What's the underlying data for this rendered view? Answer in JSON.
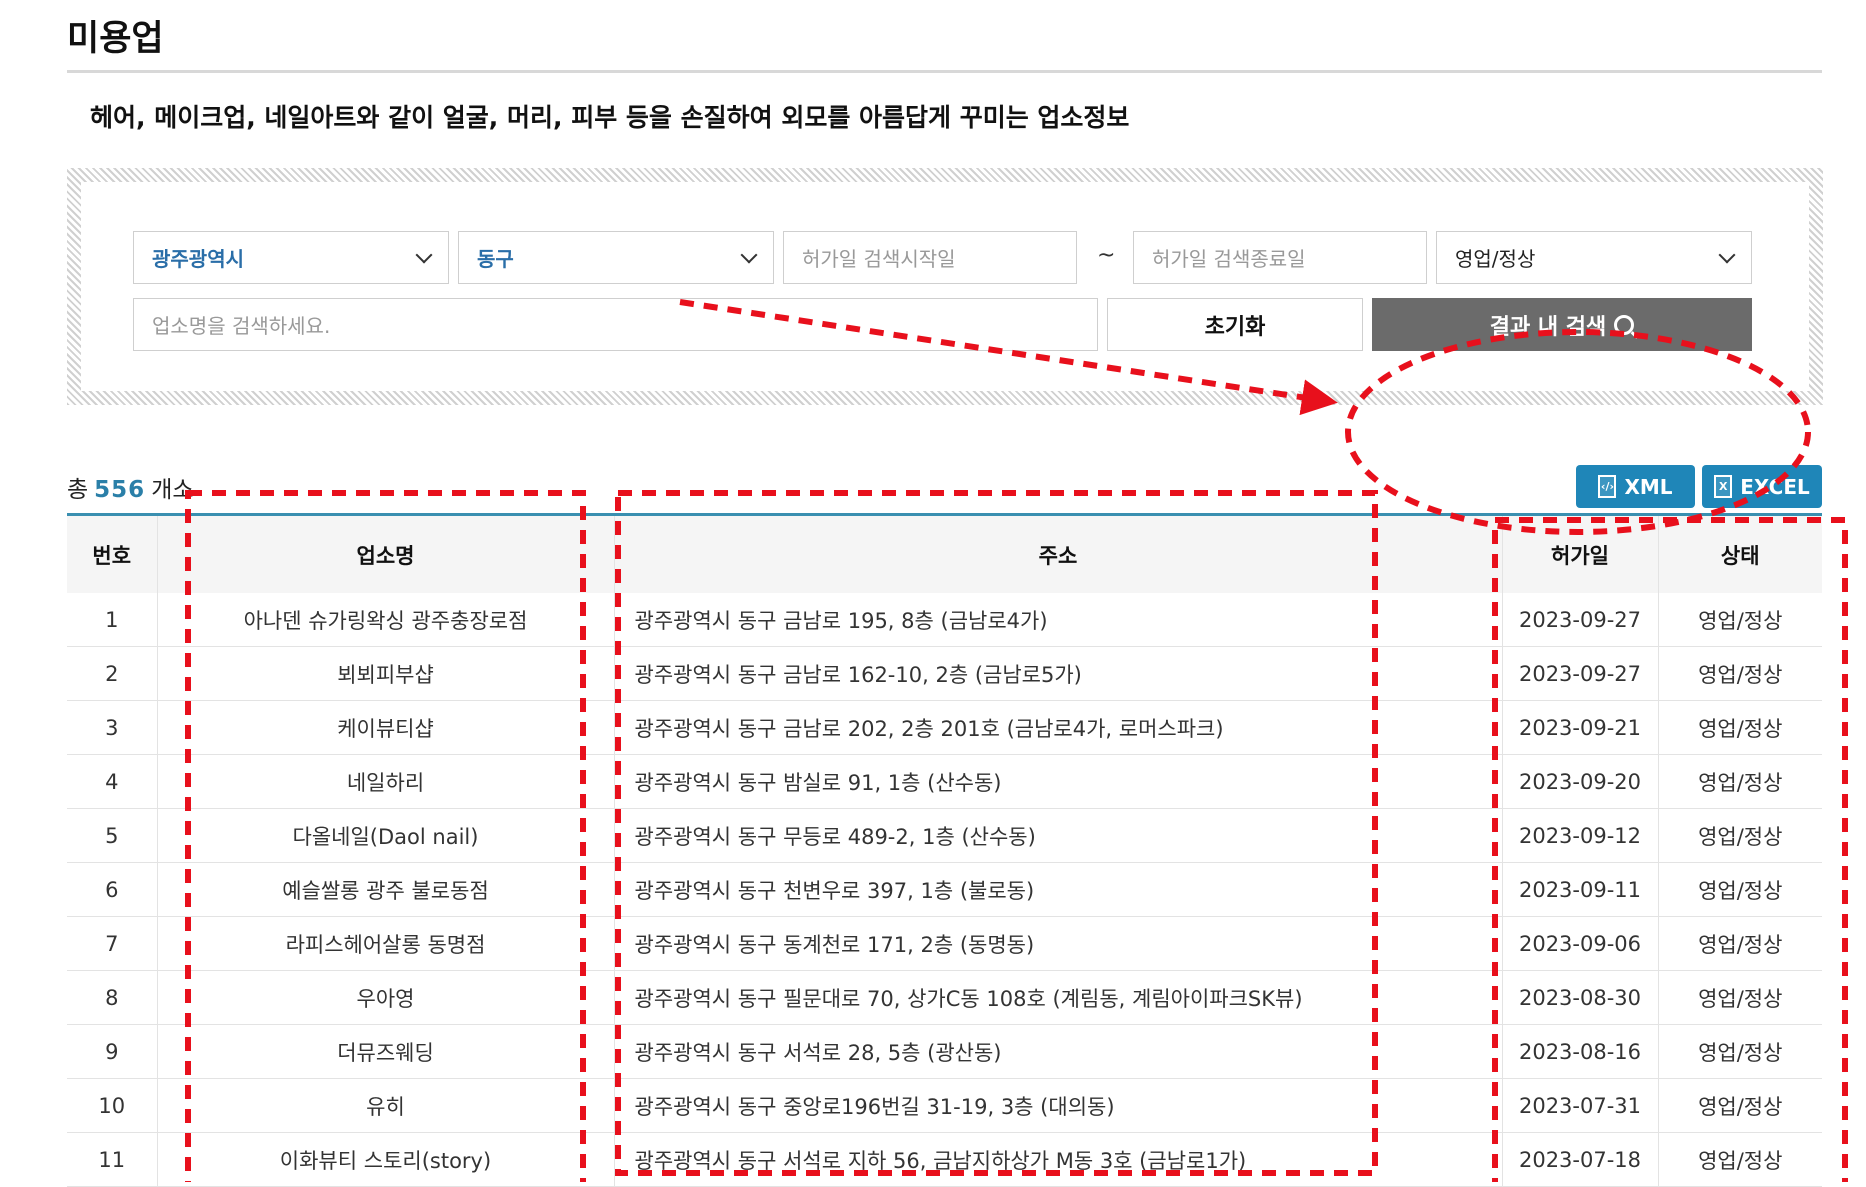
{
  "page": {
    "title": "미용업",
    "description": "헤어, 메이크업, 네일아트와 같이 얼굴, 머리, 피부 등을 손질하여 외모를 아름답게 꾸미는 업소정보"
  },
  "search": {
    "city": "광주광역시",
    "district": "동구",
    "start_date_placeholder": "허가일 검색시작일",
    "tilde": "~",
    "end_date_placeholder": "허가일 검색종료일",
    "status": "영업/정상",
    "name_placeholder": "업소명을 검색하세요.",
    "reset_label": "초기화",
    "search_label": "결과 내 검색"
  },
  "summary": {
    "prefix": "총",
    "count": "556",
    "suffix": "개소"
  },
  "downloads": {
    "xml_label": "XML",
    "excel_label": "EXCEL"
  },
  "table": {
    "headers": [
      "번호",
      "업소명",
      "주소",
      "허가일",
      "상태"
    ],
    "rows": [
      [
        "1",
        "아나덴 슈가링왁싱 광주충장로점",
        "광주광역시 동구 금남로 195, 8층 (금남로4가)",
        "2023-09-27",
        "영업/정상"
      ],
      [
        "2",
        "뵈뵈피부샵",
        "광주광역시 동구 금남로 162-10, 2층 (금남로5가)",
        "2023-09-27",
        "영업/정상"
      ],
      [
        "3",
        "케이뷰티샵",
        "광주광역시 동구 금남로 202, 2층 201호 (금남로4가, 로머스파크)",
        "2023-09-21",
        "영업/정상"
      ],
      [
        "4",
        "네일하리",
        "광주광역시 동구 밤실로 91, 1층 (산수동)",
        "2023-09-20",
        "영업/정상"
      ],
      [
        "5",
        "다올네일(Daol nail)",
        "광주광역시 동구 무등로 489-2, 1층 (산수동)",
        "2023-09-12",
        "영업/정상"
      ],
      [
        "6",
        "예슬쌀롱 광주 불로동점",
        "광주광역시 동구 천변우로 397, 1층 (불로동)",
        "2023-09-11",
        "영업/정상"
      ],
      [
        "7",
        "라피스헤어살롱 동명점",
        "광주광역시 동구 동계천로 171, 2층 (동명동)",
        "2023-09-06",
        "영업/정상"
      ],
      [
        "8",
        "우아영",
        "광주광역시 동구 필문대로 70, 상가C동 108호 (계림동, 계림아이파크SK뷰)",
        "2023-08-30",
        "영업/정상"
      ],
      [
        "9",
        "더뮤즈웨딩",
        "광주광역시 동구 서석로 28, 5층 (광산동)",
        "2023-08-16",
        "영업/정상"
      ],
      [
        "10",
        "유히",
        "광주광역시 동구 중앙로196번길 31-19, 3층 (대의동)",
        "2023-07-31",
        "영업/정상"
      ],
      [
        "11",
        "이화뷰티 스토리(story)",
        "광주광역시 동구 서석로 지하 56, 금남지하상가 M동 3호 (금남로1가)",
        "2023-07-18",
        "영업/정상"
      ]
    ]
  },
  "colors": {
    "accent_blue": "#1f86b8",
    "annotation_red": "#e8101c",
    "search_button_gray": "#6b6b6b"
  }
}
